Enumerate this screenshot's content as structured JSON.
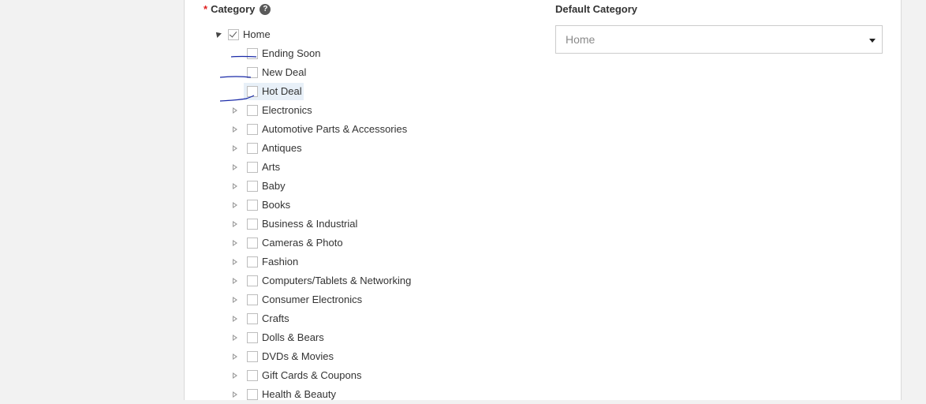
{
  "category": {
    "required_marker": "*",
    "label": "Category",
    "help_icon": "?"
  },
  "default_category": {
    "label": "Default Category",
    "selected": "Home"
  },
  "tree": {
    "root": {
      "label": "Home",
      "checked": true,
      "expanded": true
    },
    "children": [
      {
        "label": "Ending Soon",
        "has_children": false
      },
      {
        "label": "New Deal",
        "has_children": false
      },
      {
        "label": "Hot Deal",
        "has_children": false,
        "hovered": true
      },
      {
        "label": "Electronics",
        "has_children": true
      },
      {
        "label": "Automotive Parts & Accessories",
        "has_children": true
      },
      {
        "label": "Antiques",
        "has_children": true
      },
      {
        "label": "Arts",
        "has_children": true
      },
      {
        "label": "Baby",
        "has_children": true
      },
      {
        "label": "Books",
        "has_children": true
      },
      {
        "label": "Business & Industrial",
        "has_children": true
      },
      {
        "label": "Cameras & Photo",
        "has_children": true
      },
      {
        "label": "Fashion",
        "has_children": true
      },
      {
        "label": "Computers/Tablets & Networking",
        "has_children": true
      },
      {
        "label": "Consumer Electronics",
        "has_children": true
      },
      {
        "label": "Crafts",
        "has_children": true
      },
      {
        "label": "Dolls & Bears",
        "has_children": true
      },
      {
        "label": "DVDs & Movies",
        "has_children": true
      },
      {
        "label": "Gift Cards & Coupons",
        "has_children": true
      },
      {
        "label": "Health & Beauty",
        "has_children": true
      }
    ]
  },
  "colors": {
    "required": "#e02020",
    "annotation_ink": "#1a2aa8",
    "hover_bg": "#e8f0f8"
  }
}
